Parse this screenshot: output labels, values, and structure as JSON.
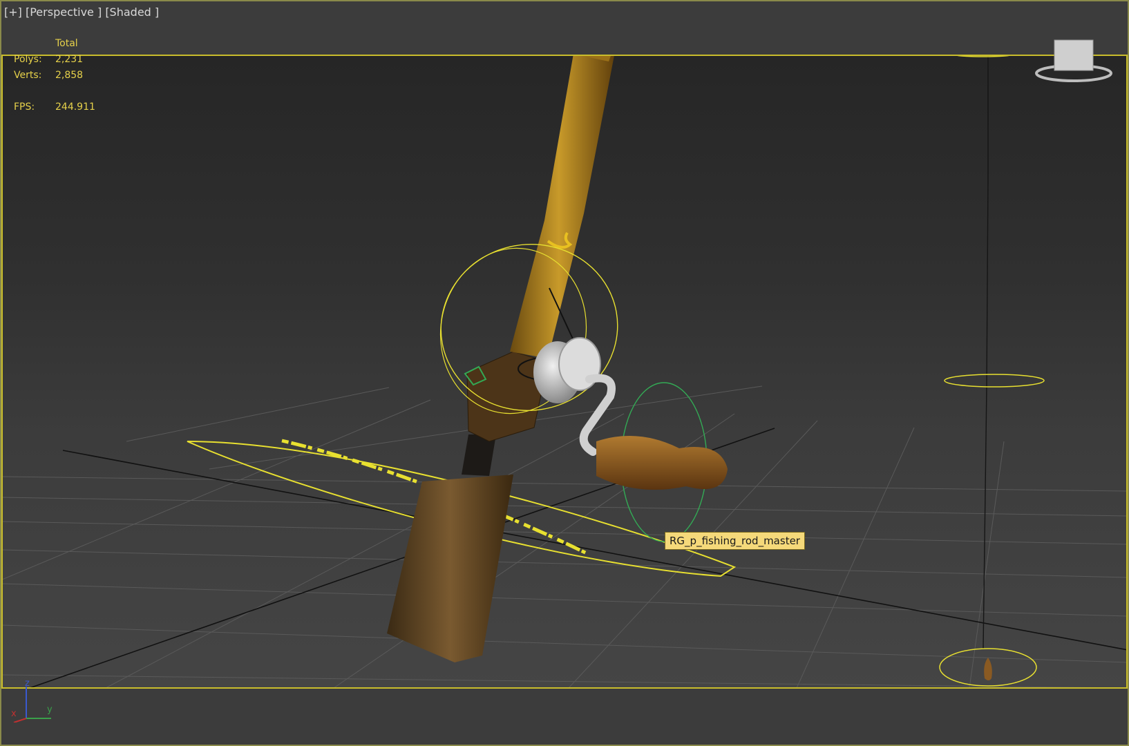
{
  "viewport": {
    "menu_plus": "[+]",
    "menu_view": "[Perspective ]",
    "menu_shading": "[Shaded ]"
  },
  "stats": {
    "header": "Total",
    "polys_label": "Polys:",
    "polys_value": "2,231",
    "verts_label": "Verts:",
    "verts_value": "2,858",
    "fps_label": "FPS:",
    "fps_value": "244.911"
  },
  "tooltip": {
    "text": "RG_p_fishing_rod_master"
  },
  "axis": {
    "x": "x",
    "y": "y",
    "z": "z"
  },
  "colors": {
    "selection": "#e8e030",
    "helper_green": "#33aa55",
    "rod_wood": "#b8861f",
    "handle_brown": "#8a5a22",
    "reel_silver": "#cfcfcf"
  }
}
